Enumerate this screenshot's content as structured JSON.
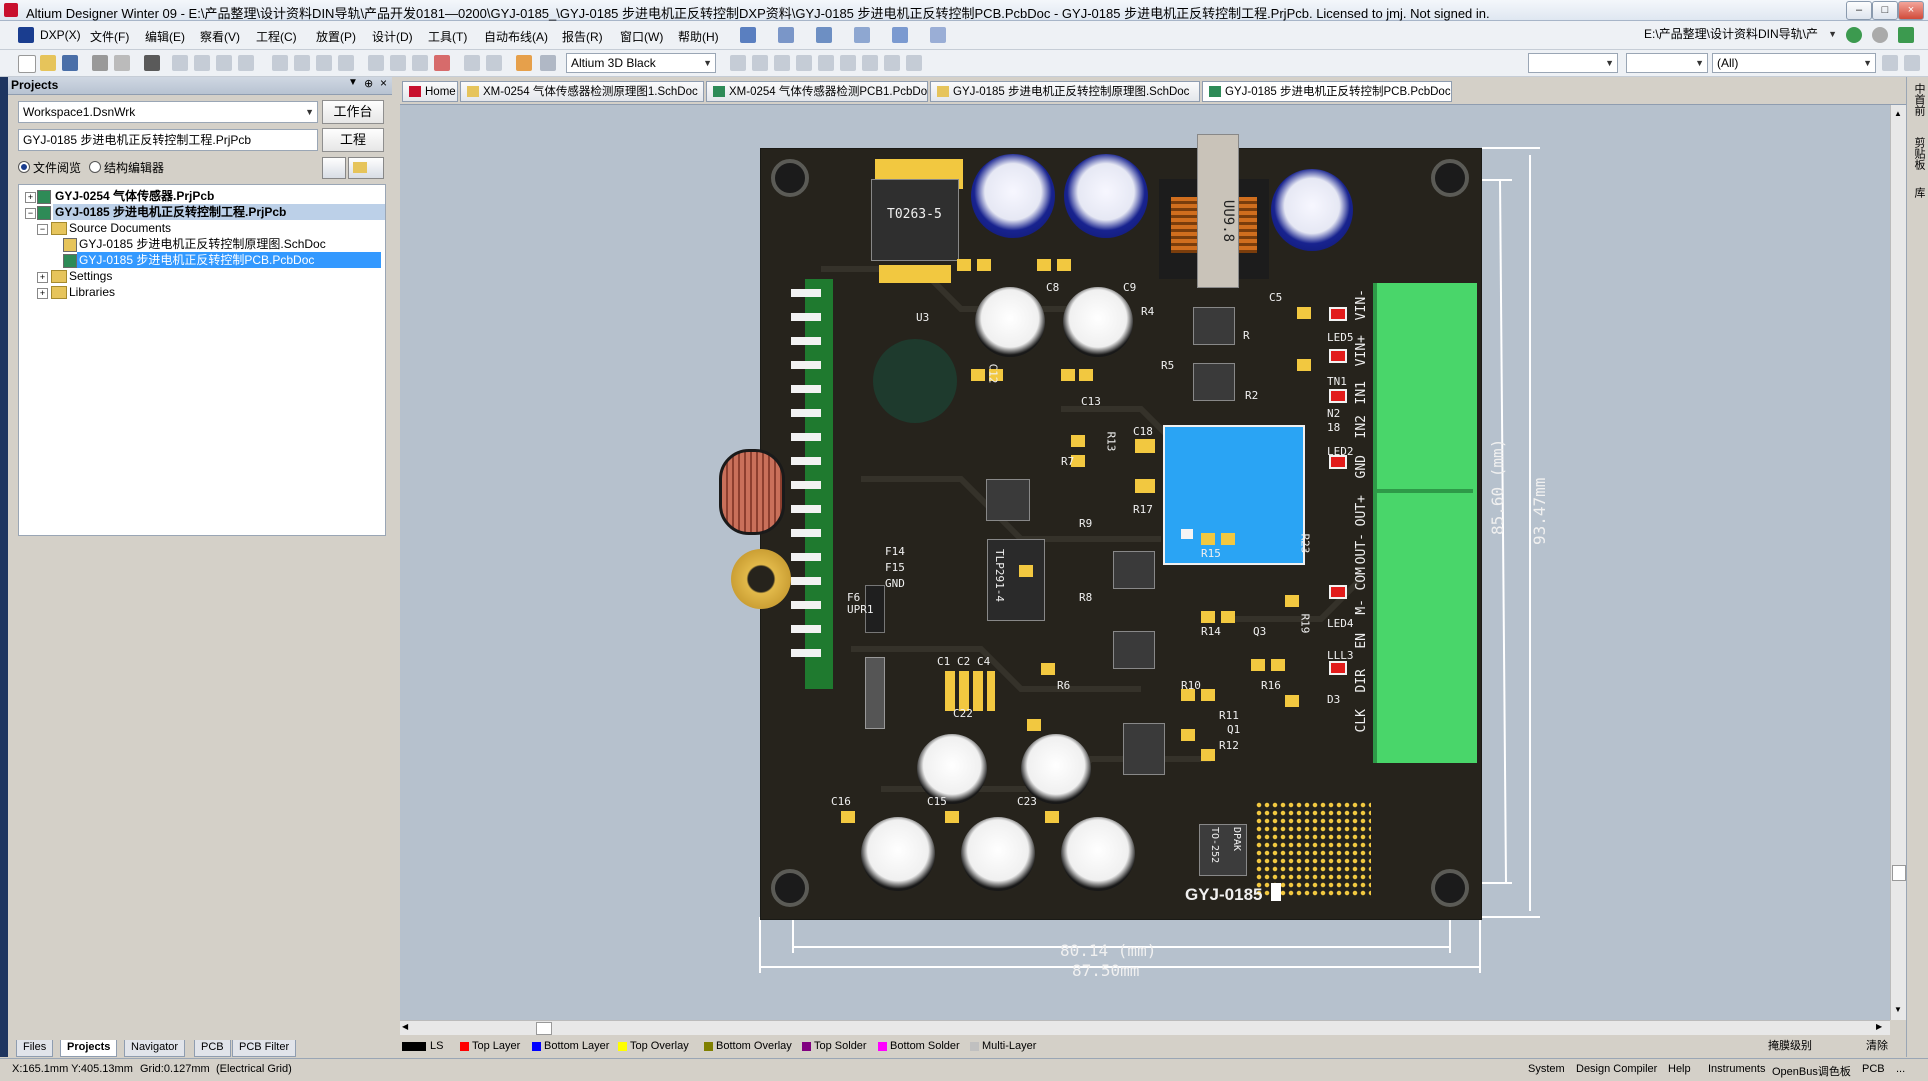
{
  "window": {
    "title": "Altium Designer Winter 09 - E:\\产品整理\\设计资料DIN导轨\\产品开发0181—0200\\GYJ-0185_\\GYJ-0185 步进电机正反转控制DXP资料\\GYJ-0185 步进电机正反转控制PCB.PcbDoc - GYJ-0185 步进电机正反转控制工程.PrjPcb. Licensed to jmj. Not signed in.",
    "minimize": "–",
    "maximize": "□",
    "close": "×"
  },
  "menu": {
    "items": [
      "DXP(X)",
      "文件(F)",
      "编辑(E)",
      "察看(V)",
      "工程(C)",
      "放置(P)",
      "设计(D)",
      "工具(T)",
      "自动布线(A)",
      "报告(R)",
      "窗口(W)",
      "帮助(H)"
    ],
    "path_combo": "E:\\产品整理\\设计资料DIN导轨\\产"
  },
  "toolbar": {
    "view_config": "Altium 3D Black",
    "filter_all": "(All)"
  },
  "panel": {
    "title": "Projects",
    "workspace": "Workspace1.DsnWrk",
    "workspace_btn": "工作台",
    "project": "GYJ-0185 步进电机正反转控制工程.PrjPcb",
    "project_btn": "工程",
    "radio_file_view": "文件阅览",
    "radio_struct_editor": "结构编辑器",
    "tree": [
      {
        "label": "GYJ-0254 气体传感器.PrjPcb",
        "bold": true
      },
      {
        "label": "GYJ-0185 步进电机正反转控制工程.PrjPcb",
        "bold": true
      },
      {
        "label": "Source Documents"
      },
      {
        "label": "GYJ-0185 步进电机正反转控制原理图.SchDoc"
      },
      {
        "label": "GYJ-0185 步进电机正反转控制PCB.PcbDoc"
      },
      {
        "label": "Settings"
      },
      {
        "label": "Libraries"
      }
    ],
    "tabs": [
      "Files",
      "Projects",
      "Navigator",
      "PCB",
      "PCB Filter"
    ]
  },
  "doc_tabs": [
    {
      "label": "Home",
      "color": "#c8102e"
    },
    {
      "label": "XM-0254 气体传感器检测原理图1.SchDoc",
      "color": "#e6c45b"
    },
    {
      "label": "XM-0254 气体传感器检测PCB1.PcbDoc",
      "color": "#2e8b57"
    },
    {
      "label": "GYJ-0185 步进电机正反转控制原理图.SchDoc",
      "color": "#e6c45b"
    },
    {
      "label": "GYJ-0185 步进电机正反转控制PCB.PcbDoc",
      "color": "#2e8b57"
    }
  ],
  "pcb": {
    "board_label": "GYJ-0185",
    "dim_width_inner": "80.14 (mm)",
    "dim_width_outer": "87.50mm",
    "dim_height_inner": "85.60 (mm)",
    "dim_height_outer": "93.47mm",
    "to263": "T0263-5",
    "inductor": "UU9.8",
    "dpak": "DPAK",
    "to252": "TO-252",
    "ic_tlp": "TLP291-4",
    "terminal_labels": [
      "VIN-",
      "VIN+",
      "IN1",
      "IN2",
      "GND",
      "OUT+",
      "OUT-",
      "COM",
      "M-",
      "EN",
      "DIR",
      "CLK"
    ],
    "refdes": [
      "C8",
      "C9",
      "C5",
      "U3",
      "C12",
      "C13",
      "R4",
      "R5",
      "R",
      "R2",
      "LED5",
      "TN1",
      "N2",
      "18",
      "C18",
      "R13",
      "R7",
      "R17",
      "LED2",
      "R9",
      "R15",
      "R23",
      "F14",
      "F15",
      "GND",
      "F6",
      "UPR1",
      "R8",
      "R14",
      "Q3",
      "R19",
      "LED4",
      "LLL3",
      "C1",
      "C2",
      "C4",
      "R6",
      "R10",
      "R16",
      "R11",
      "Q1",
      "R12",
      "C22",
      "C16",
      "C15",
      "C23",
      "D3"
    ]
  },
  "layers": [
    {
      "label": "LS",
      "color": "#000000"
    },
    {
      "label": "Top Layer",
      "color": "#ff0000"
    },
    {
      "label": "Bottom Layer",
      "color": "#0000ff"
    },
    {
      "label": "Top Overlay",
      "color": "#ffff00"
    },
    {
      "label": "Bottom Overlay",
      "color": "#808000"
    },
    {
      "label": "Top Solder",
      "color": "#800080"
    },
    {
      "label": "Bottom Solder",
      "color": "#ff00ff"
    },
    {
      "label": "Multi-Layer",
      "color": "#c0c0c0"
    }
  ],
  "layer_right": {
    "mask": "掩膜级别",
    "clear": "清除"
  },
  "status": {
    "coords": "X:165.1mm Y:405.13mm",
    "grid": "Grid:0.127mm",
    "mode": "(Electrical Grid)",
    "right": [
      "System",
      "Design Compiler",
      "Help",
      "Instruments",
      "OpenBus调色板",
      "PCB",
      "..."
    ]
  },
  "right_side": [
    "中首前",
    "剪贴板",
    "库"
  ]
}
